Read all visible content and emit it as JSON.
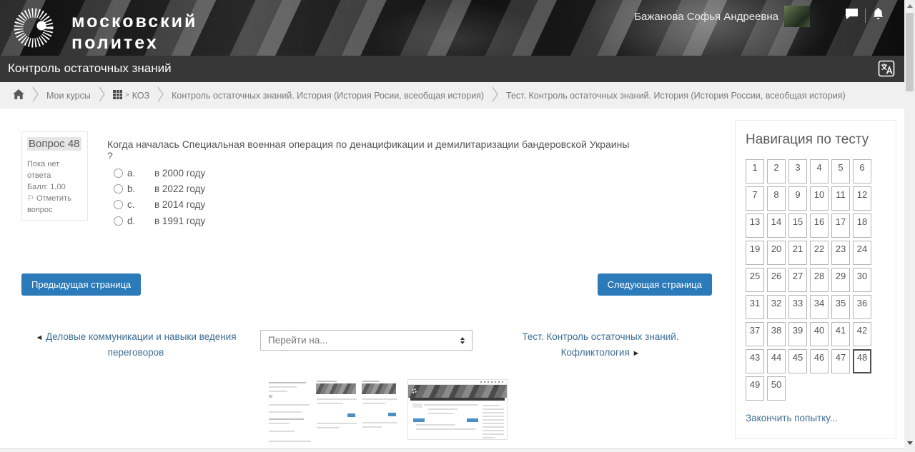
{
  "header": {
    "brand_line1": "московский",
    "brand_line2": "политех",
    "user_name": "Бажанова Софья Андреевна"
  },
  "title_bar": {
    "title": "Контроль остаточных знаний"
  },
  "breadcrumb": {
    "items": [
      {
        "label": "Мои курсы"
      },
      {
        "label": "КОЗ"
      },
      {
        "label": "Контроль остаточных знаний. История (История Росии, всеобщая история)"
      },
      {
        "label": "Тест. Контроль остаточных знаний. История (История России, всеобщая история)"
      }
    ]
  },
  "question": {
    "number_label": "Вопрос 48",
    "status": "Пока нет ответа",
    "points": "Балл: 1,00",
    "flag_label": "Отметить вопрос",
    "text": "Когда началась Специальная военная операция по денацификации и демилитаризации бандеровской Украины ?",
    "options": [
      {
        "letter": "a.",
        "label": "в 2000 году"
      },
      {
        "letter": "b.",
        "label": "в 2022 году"
      },
      {
        "letter": "c.",
        "label": "в 2014 году"
      },
      {
        "letter": "d.",
        "label": "в 1991 году"
      }
    ]
  },
  "paging": {
    "prev_label": "Предыдущая страница",
    "next_label": "Следующая страница"
  },
  "activity_nav": {
    "prev_arrow": "◄",
    "prev_label": "Деловые коммуникации и навыки ведения переговоров",
    "jump_value": "Перейти на...",
    "next_label": "Тест. Контроль остаточных знаний. Кофликтология",
    "next_arrow": "►"
  },
  "quiz_nav": {
    "title": "Навигация по тесту",
    "question_count": 50,
    "current_question": 48,
    "finish_label": "Закончить попытку..."
  },
  "colors": {
    "accent_blue": "#2b7ab9",
    "link_blue": "#3d6e96",
    "dark_bar": "#373737"
  }
}
